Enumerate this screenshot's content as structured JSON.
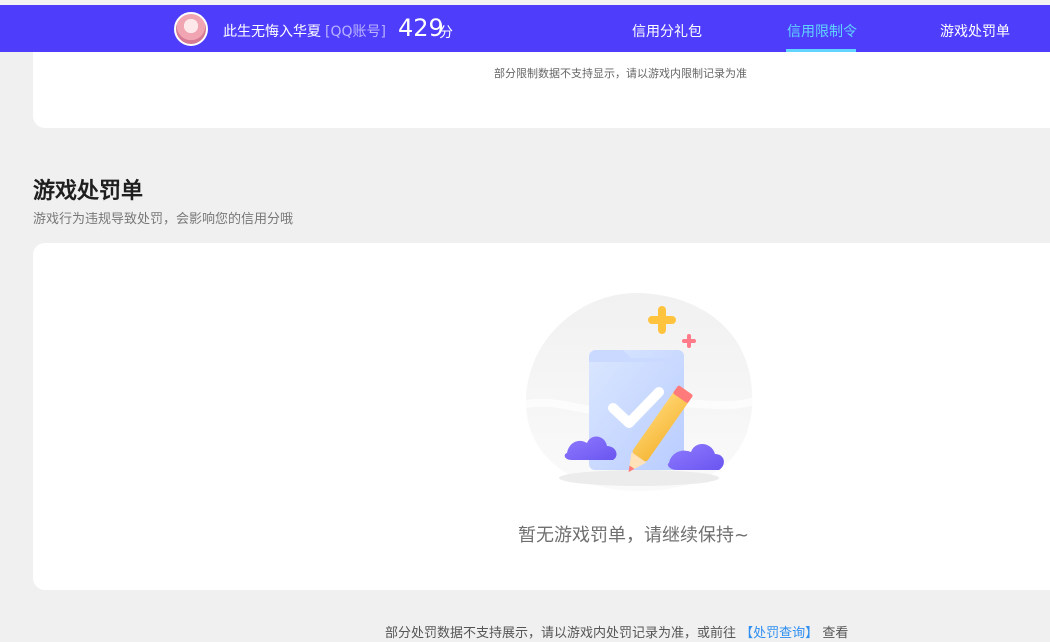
{
  "header": {
    "username": "此生无悔入华夏",
    "account_type": "[QQ账号]",
    "score": "429",
    "score_unit": "分",
    "tabs": [
      {
        "label": "信用分礼包",
        "active": false
      },
      {
        "label": "信用限制令",
        "active": true
      },
      {
        "label": "游戏处罚单",
        "active": false
      }
    ],
    "accent_color": "#4f3dfc",
    "active_tab_color": "#61d4ff"
  },
  "limit_section": {
    "note": "部分限制数据不支持显示，请以游戏内限制记录为准"
  },
  "penalty_section": {
    "title": "游戏处罚单",
    "subtitle": "游戏行为违规导致处罚，会影响您的信用分哦",
    "empty_message": "暂无游戏罚单，请继续保持~",
    "empty_icon": "empty-clipboard-illustration",
    "bottom_note_prefix": "部分处罚数据不支持展示，请以游戏内处罚记录为准，或前往",
    "bottom_link": "【处罚查询】",
    "bottom_note_suffix": "查看"
  }
}
